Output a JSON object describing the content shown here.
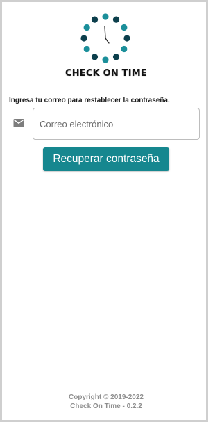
{
  "logo": {
    "brand": "CHECK ON TIME",
    "icon": "clock-icon",
    "colors": {
      "dark": "#0c3f4c",
      "light": "#1b8f9a",
      "hands": "#222222"
    }
  },
  "form": {
    "instruction": "Ingresa tu correo para restablecer la contraseña.",
    "email_icon": "mail-icon",
    "email_placeholder": "Correo electrónico",
    "email_value": "",
    "submit_label": "Recuperar contraseña"
  },
  "footer": {
    "copyright": "Copyright © 2019-2022",
    "version": "Check On Time - 0.2.2"
  },
  "colors": {
    "accent": "#16878f",
    "text": "#1a1a1a",
    "muted": "#8e8e8e"
  }
}
